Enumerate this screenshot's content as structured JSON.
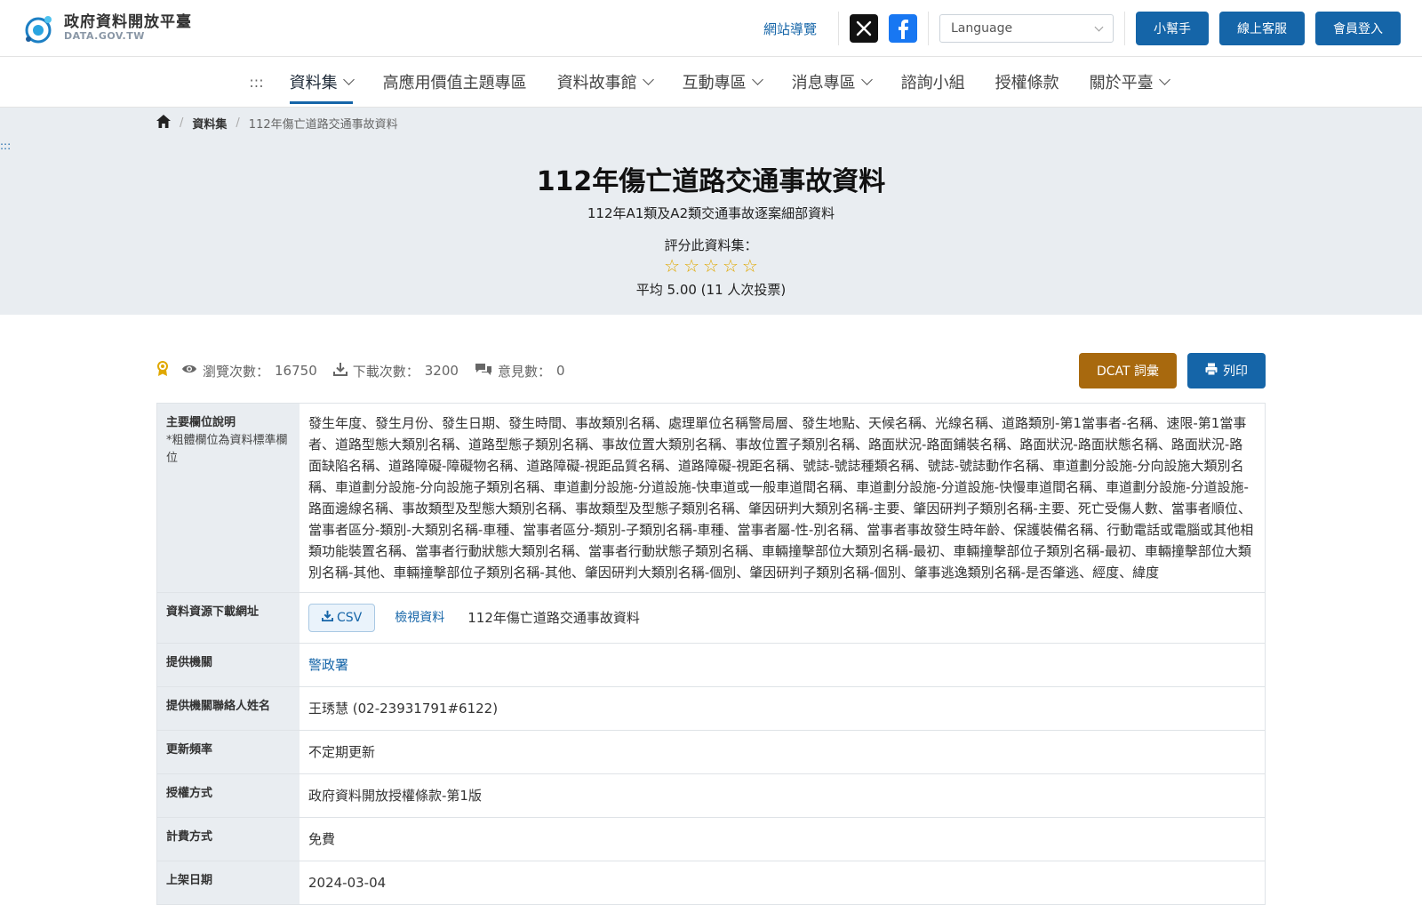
{
  "header": {
    "logo_zh": "政府資料開放平臺",
    "logo_en": "DATA.GOV.TW",
    "sitemap": "網站導覽",
    "language_placeholder": "Language",
    "buttons": [
      "小幫手",
      "線上客服",
      "會員登入"
    ]
  },
  "nav": {
    "accesskey": ":::",
    "items": [
      {
        "label": "資料集",
        "dropdown": true
      },
      {
        "label": "高應用價值主題專區",
        "dropdown": false
      },
      {
        "label": "資料故事館",
        "dropdown": true
      },
      {
        "label": "互動專區",
        "dropdown": true
      },
      {
        "label": "消息專區",
        "dropdown": true
      },
      {
        "label": "諮詢小組",
        "dropdown": false
      },
      {
        "label": "授權條款",
        "dropdown": false
      },
      {
        "label": "關於平臺",
        "dropdown": true
      }
    ]
  },
  "breadcrumb": {
    "section": "資料集",
    "current": "112年傷亡道路交通事故資料"
  },
  "side_accesskey": ":::",
  "dataset": {
    "title": "112年傷亡道路交通事故資料",
    "subtitle": "112年A1類及A2類交通事故逐案細部資料",
    "rate_label": "評分此資料集：",
    "rating_summary": "平均 5.00 (11 人次投票)",
    "rating_stars_filled": 0,
    "rating_stars_total": 5
  },
  "stats": {
    "views_label": "瀏覽次數：",
    "views_value": "16750",
    "downloads_label": "下載次數：",
    "downloads_value": "3200",
    "comments_label": "意見數：",
    "comments_value": "0",
    "dcat_button": "DCAT 詞彙",
    "print_button": "列印"
  },
  "table": {
    "fields_label": "主要欄位說明",
    "fields_note": "*粗體欄位為資料標準欄位",
    "fields_value": "發生年度、發生月份、發生日期、發生時間、事故類別名稱、處理單位名稱警局層、發生地點、天候名稱、光線名稱、道路類別-第1當事者-名稱、速限-第1當事者、道路型態大類別名稱、道路型態子類別名稱、事故位置大類別名稱、事故位置子類別名稱、路面狀況-路面鋪裝名稱、路面狀況-路面狀態名稱、路面狀況-路面缺陷名稱、道路障礙-障礙物名稱、道路障礙-視距品質名稱、道路障礙-視距名稱、號誌-號誌種類名稱、號誌-號誌動作名稱、車道劃分設施-分向設施大類別名稱、車道劃分設施-分向設施子類別名稱、車道劃分設施-分道設施-快車道或一般車道間名稱、車道劃分設施-分道設施-快慢車道間名稱、車道劃分設施-分道設施-路面邊線名稱、事故類型及型態大類別名稱、事故類型及型態子類別名稱、肇因研判大類別名稱-主要、肇因研判子類別名稱-主要、死亡受傷人數、當事者順位、當事者區分-類別-大類別名稱-車種、當事者區分-類別-子類別名稱-車種、當事者屬-性-別名稱、當事者事故發生時年齡、保護裝備名稱、行動電話或電腦或其他相類功能裝置名稱、當事者行動狀態大類別名稱、當事者行動狀態子類別名稱、車輛撞擊部位大類別名稱-最初、車輛撞擊部位子類別名稱-最初、車輛撞擊部位大類別名稱-其他、車輛撞擊部位子類別名稱-其他、肇因研判大類別名稱-個別、肇因研判子類別名稱-個別、肇事逃逸類別名稱-是否肇逃、經度、緯度",
    "resource_label": "資料資源下載網址",
    "resource_format": "CSV",
    "resource_view": "檢視資料",
    "resource_name": "112年傷亡道路交通事故資料",
    "provider_label": "提供機關",
    "provider_value": "警政署",
    "contact_label": "提供機關聯絡人姓名",
    "contact_value": "王琇慧 (02-23931791#6122)",
    "frequency_label": "更新頻率",
    "frequency_value": "不定期更新",
    "license_label": "授權方式",
    "license_value": "政府資料開放授權條款-第1版",
    "fee_label": "計費方式",
    "fee_value": "免費",
    "published_label": "上架日期",
    "published_value": "2024-03-04"
  },
  "colors": {
    "primary": "#1565a8",
    "dcat": "#a8690e",
    "band": "#e9edf1",
    "star": "#e0a800"
  }
}
